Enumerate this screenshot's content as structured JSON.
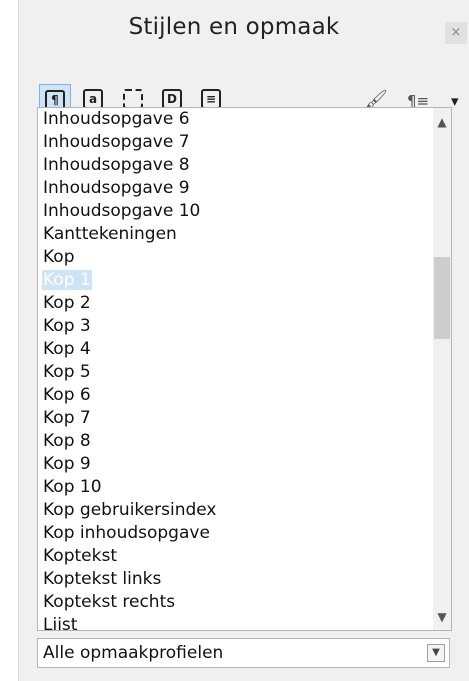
{
  "panel": {
    "title": "Stijlen en opmaak",
    "close_glyph": "×"
  },
  "toolbar": {
    "buttons": [
      {
        "icon": "paragraph-styles-icon",
        "glyph": "¶",
        "active": true
      },
      {
        "icon": "character-styles-icon",
        "glyph": "a",
        "active": false
      },
      {
        "icon": "frame-styles-icon",
        "glyph": "",
        "active": false
      },
      {
        "icon": "page-styles-icon",
        "glyph": "D",
        "active": false
      },
      {
        "icon": "list-styles-icon",
        "glyph": "≡",
        "active": false
      }
    ],
    "fill_format_glyph": "🖌",
    "new_style_glyph": "¶≡",
    "menu_glyph": "▾"
  },
  "styles_list": {
    "items": [
      "Inhoudsopgave 6",
      "Inhoudsopgave 7",
      "Inhoudsopgave 8",
      "Inhoudsopgave 9",
      "Inhoudsopgave 10",
      "Kanttekeningen",
      "Kop",
      "Kop 1",
      "Kop 2",
      "Kop 3",
      "Kop 4",
      "Kop 5",
      "Kop 6",
      "Kop 7",
      "Kop 8",
      "Kop 9",
      "Kop 10",
      "Kop gebruikersindex",
      "Kop inhoudsopgave",
      "Koptekst",
      "Koptekst links",
      "Koptekst rechts",
      "Lijst"
    ],
    "selected": "Kop 1",
    "scroll_up_glyph": "▲",
    "scroll_down_glyph": "▼"
  },
  "filter": {
    "value": "Alle opmaakprofielen",
    "arrow_glyph": "▼"
  }
}
